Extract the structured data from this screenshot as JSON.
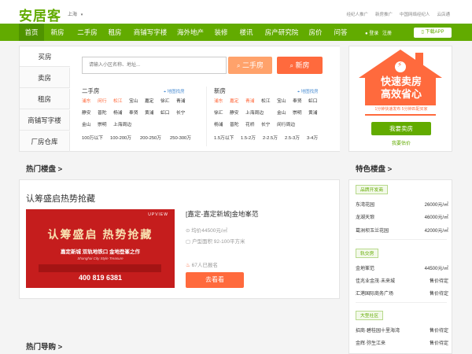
{
  "header": {
    "logo": "安居客",
    "city": "上海",
    "top_links": [
      "经纪人推广",
      "新房推广",
      "中国网络经纪人",
      "云店通"
    ]
  },
  "nav": {
    "items": [
      "首页",
      "新房",
      "二手房",
      "租房",
      "商铺写字楼",
      "海外地产",
      "装修",
      "楼讯",
      "房产研究院",
      "房价",
      "问答"
    ],
    "login": "登录",
    "register": "注册",
    "download": "下载APP"
  },
  "search": {
    "tabs": [
      "买房",
      "卖房",
      "租房",
      "商铺写字楼",
      "厂房仓库"
    ],
    "placeholder": "请输入小区名称、地址...",
    "second_hand_btn": "二手房",
    "new_house_btn": "新房",
    "second_hand": {
      "title": "二手房",
      "map": "地图找房",
      "districts_orange": [
        "浦东",
        "闵行",
        "松江"
      ],
      "districts": [
        "宝山",
        "嘉定",
        "徐汇",
        "青浦",
        "静安",
        "普陀",
        "杨浦",
        "奉贤",
        "黄浦",
        "虹口",
        "长宁",
        "金山",
        "崇明",
        "上海周边"
      ],
      "prices": [
        "100万以下",
        "100-200万",
        "200-250万",
        "250-300万"
      ]
    },
    "new_house": {
      "title": "新房",
      "map": "地图找房",
      "districts_orange": [
        "浦东",
        "嘉定",
        "青浦"
      ],
      "districts": [
        "松江",
        "宝山",
        "奉贤",
        "虹口",
        "徐汇",
        "静安",
        "上海周边",
        "金山",
        "崇明",
        "黄浦",
        "杨浦",
        "普陀",
        "花桥",
        "长宁",
        "闵行周边"
      ],
      "prices": [
        "1.5万以下",
        "1.5-2万",
        "2-2.5万",
        "2.5-3万",
        "3-4万"
      ]
    }
  },
  "sell": {
    "line1": "快速卖房",
    "line2": "高效省心",
    "bar": "1分钟快速发布 5分钟匹配买家",
    "button": "我要卖房",
    "estimate": "我要估价"
  },
  "hot": {
    "title": "热门楼盘 >",
    "promo_title": "认筹盛启热势抢藏",
    "banner": {
      "brand": "UPVIEW",
      "headline": "认筹盛启 热势抢藏",
      "sub": "嘉定新城 双轨地铁口 金地登峯之作",
      "line": "Shanghai City Style Treasure",
      "phone": "400 819 6381"
    },
    "project_name": "[嘉定-嘉定新城]金地峯范",
    "price": "均价44500元/㎡",
    "area": "户型面积 92-100平方米",
    "signups": "67人已报名",
    "cta": "去看看"
  },
  "featured": {
    "title": "特色楼盘 >",
    "groups": [
      {
        "tag": "品牌开发商",
        "rows": [
          {
            "name": "东湾花园",
            "price": "26000元/㎡"
          },
          {
            "name": "龙湖天琅",
            "price": "46000元/㎡"
          },
          {
            "name": "葛洲坝玉兰花园",
            "price": "42000元/㎡"
          }
        ]
      },
      {
        "tag": "轨交房",
        "rows": [
          {
            "name": "金地峯范",
            "price": "44500元/㎡"
          },
          {
            "name": "佳兆业金茂·未来城",
            "price": "售价待定"
          },
          {
            "name": "汇港国际商务广场",
            "price": "售价待定"
          }
        ]
      },
      {
        "tag": "大型社区",
        "rows": [
          {
            "name": "招商·碧桂园十里海湾",
            "price": "售价待定"
          },
          {
            "name": "金辉·弥生江来",
            "price": "售价待定"
          }
        ]
      }
    ]
  },
  "guide": {
    "title": "热门导购 >"
  },
  "colors": {
    "brand_green": "#62ab00",
    "orange": "#ff6a3d",
    "red_banner": "#c51d1d"
  },
  "icons": [
    "chevron-down-icon",
    "map-pin-icon",
    "phone-icon",
    "price-icon",
    "area-icon",
    "fire-icon",
    "lightning-icon"
  ]
}
